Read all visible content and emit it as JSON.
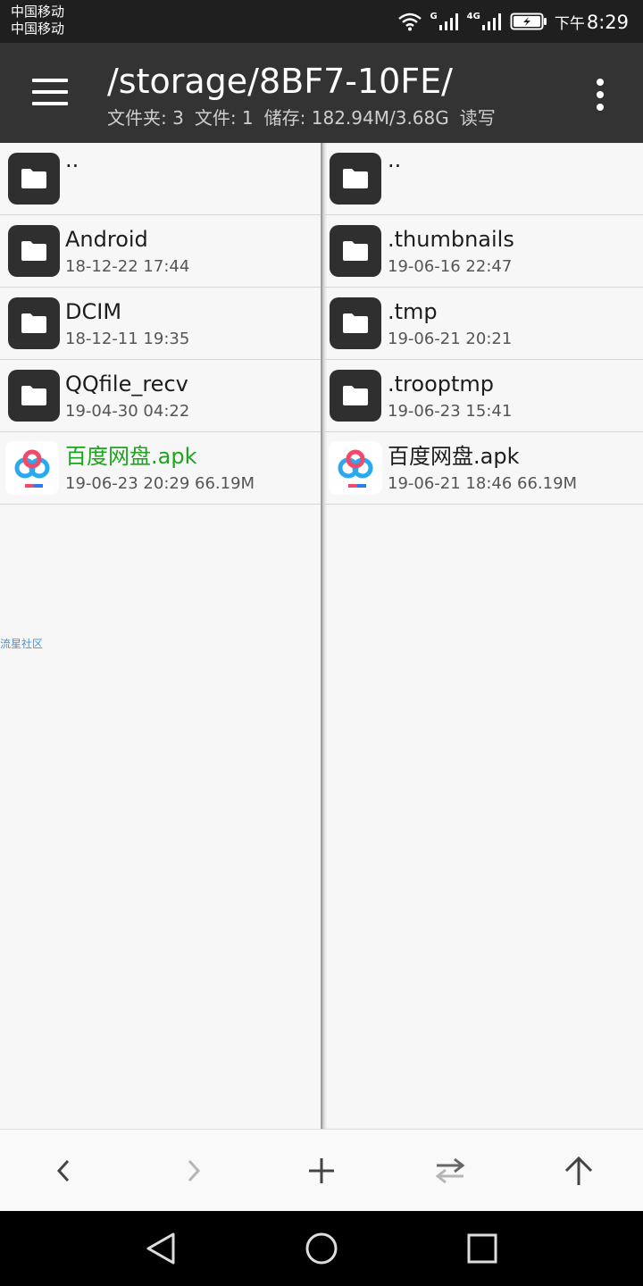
{
  "status_bar": {
    "carrier_line1": "中国移动",
    "carrier_line2": "中国移动",
    "network_1": "G",
    "network_2": "4G",
    "time_prefix": "下午",
    "time": "8:29",
    "icons": [
      "wifi-icon",
      "signal-icon",
      "battery-charging-icon"
    ]
  },
  "app_bar": {
    "path": "/storage/8BF7-10FE/",
    "folders": "文件夹: 3",
    "files": "文件: 1",
    "storage": "储存: 182.94M/3.68G",
    "mode": "读写"
  },
  "left_pane": {
    "items": [
      {
        "name": "..",
        "meta": "",
        "icon": "folder-icon"
      },
      {
        "name": "Android",
        "meta": "18-12-22 17:44",
        "icon": "folder-icon"
      },
      {
        "name": "DCIM",
        "meta": "18-12-11 19:35",
        "icon": "folder-icon"
      },
      {
        "name": "QQfile_recv",
        "meta": "19-04-30 04:22",
        "icon": "folder-icon"
      },
      {
        "name": "百度网盘.apk",
        "meta": "19-06-23 20:29  66.19M",
        "icon": "baidu-netdisk-icon"
      }
    ],
    "watermark": "流星社区"
  },
  "right_pane": {
    "items": [
      {
        "name": "..",
        "meta": "",
        "icon": "folder-icon"
      },
      {
        "name": ".thumbnails",
        "meta": "19-06-16 22:47",
        "icon": "folder-icon"
      },
      {
        "name": ".tmp",
        "meta": "19-06-21 20:21",
        "icon": "folder-icon"
      },
      {
        "name": ".trooptmp",
        "meta": "19-06-23 15:41",
        "icon": "folder-icon"
      },
      {
        "name": "百度网盘.apk",
        "meta": "19-06-21 18:46  66.19M",
        "icon": "baidu-netdisk-icon"
      }
    ]
  },
  "toolbar": {
    "buttons": [
      "back-icon",
      "forward-icon",
      "add-icon",
      "swap-icon",
      "up-icon"
    ]
  },
  "colors": {
    "app_bar": "#333333",
    "selected_file": "#1ea41e",
    "folder_icon": "#2f2f2f"
  }
}
